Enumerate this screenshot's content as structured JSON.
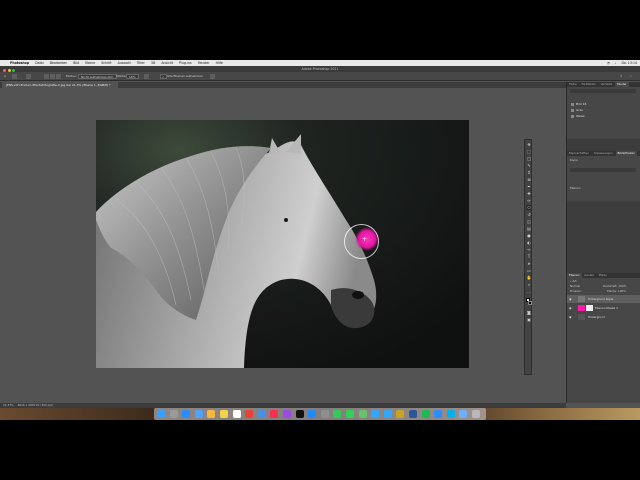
{
  "menubar": {
    "app": "Photoshop",
    "menus": [
      "Datei",
      "Bearbeiten",
      "Bild",
      "Ebene",
      "Schrift",
      "Auswahl",
      "Filter",
      "3D",
      "Ansicht",
      "Plug-ins",
      "Fenster",
      "Hilfe"
    ],
    "clock": "Do. 13:14"
  },
  "window": {
    "title": "Adobe Photoshop 2021"
  },
  "options": {
    "modus_label": "Modus:",
    "modus_value": "Nicht aufnehmen-Um.",
    "staerke_label": "Stärke:",
    "staerke_value": "16%",
    "alle_ebenen": "Alle Ebenen aufnehmen"
  },
  "document": {
    "tab_label": "JENS+KH-Enduro-Pferdefotografie-2.jpg bei 21,3% (Ebene 1, RGB/8) *"
  },
  "status": {
    "zoom": "21,33%",
    "size": "6016 x 4000 Px (300 ppi)"
  },
  "panels": {
    "top_tabs": [
      "Farbe",
      "Farbfelder",
      "Verläufe",
      "Muster"
    ],
    "library_items": [
      "Bild 16",
      "Grau",
      "Weiss"
    ],
    "mid_tabs": [
      "Eigenschaften",
      "Anpassungen",
      "Bibliotheken"
    ],
    "mid_label": "Kopie",
    "mid_label2": "Ebenen",
    "layer_tabs": [
      "Ebenen",
      "Kanäle",
      "Pfade"
    ],
    "layer_search": "Art",
    "blend_mode": "Normal",
    "opacity_label": "Deckkraft:",
    "opacity_value": "100%",
    "lock_label": "Fixieren:",
    "fill_label": "Fläche:",
    "fill_value": "100%",
    "layers": [
      {
        "name": "Hintergrund Kopie",
        "selected": true
      },
      {
        "name": "Ebenen Maske 1",
        "selected": false
      },
      {
        "name": "Hintergrund",
        "selected": false
      }
    ]
  },
  "colors": {
    "ps_bg": "#535353",
    "panel": "#3c3c3c",
    "brush_magenta": "#ff1aa8"
  },
  "dock_apps": [
    "finder-icon",
    "launchpad-icon",
    "safari-icon",
    "mail-icon",
    "photos-icon",
    "notes-icon",
    "calendar-icon",
    "chrome-icon",
    "files-icon",
    "music-icon",
    "podcasts-icon",
    "tv-icon",
    "appstore-icon",
    "settings-icon",
    "messages-icon",
    "facetime-icon",
    "maps-icon",
    "photoshop-icon",
    "lightroom-icon",
    "bridge-icon",
    "word-icon",
    "spotify-icon",
    "zoom-icon",
    "skype-icon",
    "preview-icon",
    "trash-icon"
  ]
}
